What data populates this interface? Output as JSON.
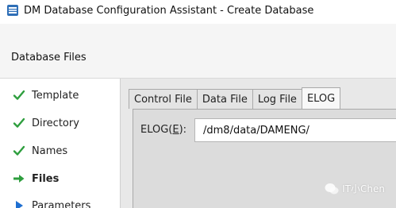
{
  "window": {
    "title": "DM Database Configuration Assistant - Create Database",
    "icon": "dm-app-icon"
  },
  "header": {
    "title": "Database Files"
  },
  "sidebar": {
    "steps": [
      {
        "label": "Template",
        "state": "done",
        "icon": "check-icon"
      },
      {
        "label": "Directory",
        "state": "done",
        "icon": "check-icon"
      },
      {
        "label": "Names",
        "state": "done",
        "icon": "check-icon"
      },
      {
        "label": "Files",
        "state": "current",
        "icon": "arrow-right-icon"
      },
      {
        "label": "Parameters",
        "state": "pending",
        "icon": "triangle-right-icon"
      }
    ]
  },
  "tabs": [
    {
      "label": "Control File",
      "selected": false
    },
    {
      "label": "Data File",
      "selected": false
    },
    {
      "label": "Log File",
      "selected": false
    },
    {
      "label": "ELOG",
      "selected": true
    }
  ],
  "elog": {
    "label": "ELOG(E):",
    "label_prefix": "ELOG(",
    "label_mnemonic": "E",
    "label_suffix": "):",
    "value": "/dm8/data/DAMENG/"
  },
  "watermark": {
    "text": "IT小Chen"
  },
  "colors": {
    "check": "#2e9e3e",
    "arrow": "#2e9e3e",
    "triangle": "#1f6fd1"
  }
}
